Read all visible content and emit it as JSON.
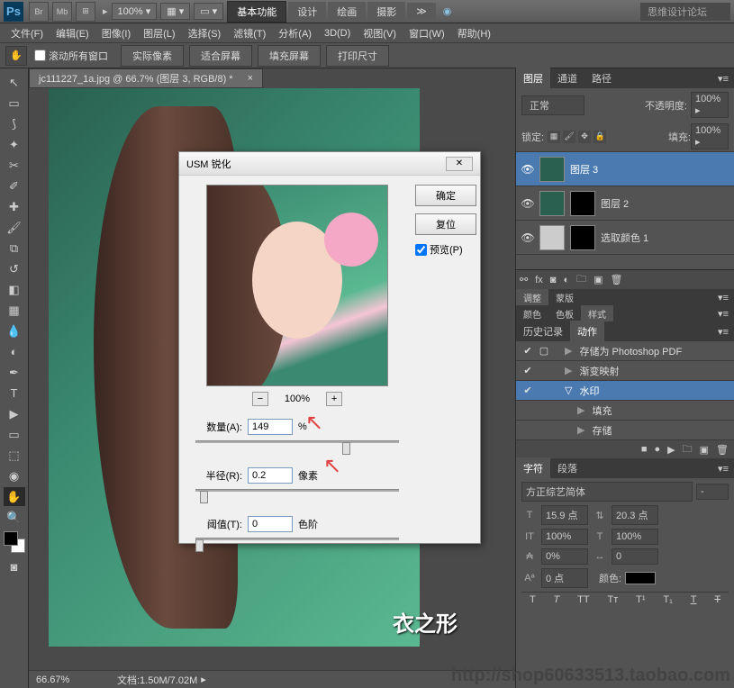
{
  "topbar": {
    "zoom_dd": "100% ▾",
    "view_dd": "▦ ▾",
    "screen_dd": "▭ ▾",
    "workspaces": [
      "基本功能",
      "设计",
      "绘画",
      "摄影",
      "≫"
    ],
    "active_workspace": 0,
    "search_placeholder": "思维设计论坛"
  },
  "menubar": [
    "文件(F)",
    "编辑(E)",
    "图像(I)",
    "图层(L)",
    "选择(S)",
    "滤镜(T)",
    "分析(A)",
    "3D(D)",
    "视图(V)",
    "窗口(W)",
    "帮助(H)"
  ],
  "optionsbar": {
    "scroll_all": "滚动所有窗口",
    "buttons": [
      "实际像素",
      "适合屏幕",
      "填充屏幕",
      "打印尺寸"
    ]
  },
  "document": {
    "tab_title": "jc111227_1a.jpg @ 66.7% (图层 3, RGB/8) *"
  },
  "statusbar": {
    "zoom": "66.67%",
    "docinfo": "文档:1.50M/7.02M"
  },
  "layers_panel": {
    "tabs": [
      "图层",
      "通道",
      "路径"
    ],
    "active_tab": 0,
    "blend_mode": "正常",
    "opacity_label": "不透明度:",
    "opacity_value": "100% ▸",
    "lock_label": "锁定:",
    "fill_label": "填充:",
    "fill_value": "100% ▸",
    "layers": [
      {
        "name": "图层 3",
        "visible": true,
        "selected": true,
        "has_mask": false
      },
      {
        "name": "图层 2",
        "visible": true,
        "selected": false,
        "has_mask": true
      },
      {
        "name": "选取颜色 1",
        "visible": true,
        "selected": false,
        "is_adjustment": true,
        "has_mask": true
      }
    ]
  },
  "mini_panel1": {
    "tabs": [
      "调整",
      "蒙版"
    ],
    "active": 0
  },
  "mini_panel2": {
    "tabs": [
      "颜色",
      "色板",
      "样式"
    ],
    "active": 2
  },
  "history_panel": {
    "tabs": [
      "历史记录",
      "动作"
    ],
    "active_tab": 1,
    "actions": [
      {
        "name": "存储为 Photoshop PDF",
        "indent": 1,
        "expanded": false
      },
      {
        "name": "渐变映射",
        "indent": 1,
        "expanded": false
      },
      {
        "name": "水印",
        "indent": 1,
        "expanded": true,
        "selected": true
      },
      {
        "name": "填充",
        "indent": 2,
        "expanded": false
      },
      {
        "name": "存储",
        "indent": 2,
        "expanded": false
      }
    ]
  },
  "char_panel": {
    "tabs": [
      "字符",
      "段落"
    ],
    "active_tab": 0,
    "font_family": "方正综艺简体",
    "font_style": "-",
    "font_size": "15.9 点",
    "leading": "20.3 点",
    "scale_v": "100%",
    "scale_h": "100%",
    "tracking": "0%",
    "kerning": "0",
    "baseline": "0 点",
    "color_label": "颜色:"
  },
  "dialog": {
    "title": "USM 锐化",
    "ok": "确定",
    "cancel": "复位",
    "preview": "预览(P)",
    "zoom_level": "100%",
    "amount_label": "数量(A):",
    "amount_value": "149",
    "amount_unit": "%",
    "radius_label": "半径(R):",
    "radius_value": "0.2",
    "radius_unit": "像素",
    "threshold_label": "阈值(T):",
    "threshold_value": "0",
    "threshold_unit": "色阶"
  },
  "watermark_brand": "衣之形",
  "watermark_url": "http://shop60633513.taobao.com"
}
